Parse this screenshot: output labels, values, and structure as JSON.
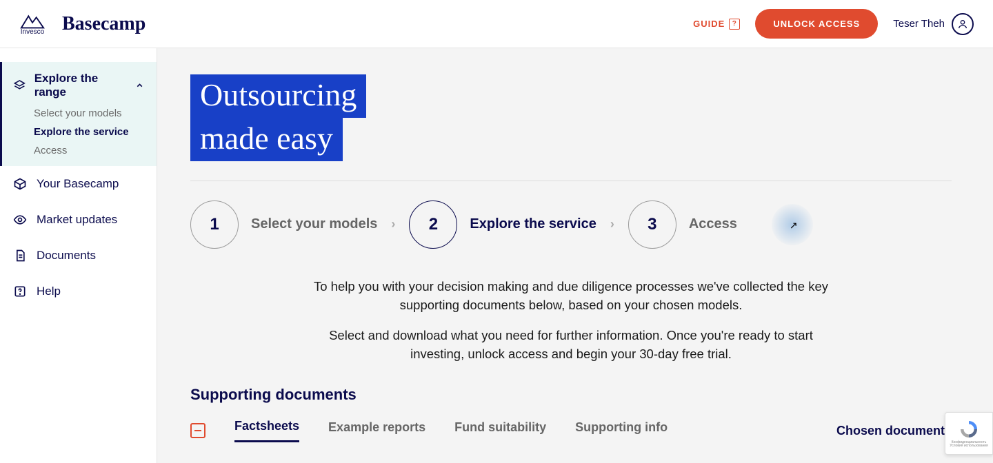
{
  "header": {
    "logo_text": "Invesco",
    "brand": "Basecamp",
    "guide_label": "GUIDE",
    "unlock_label": "UNLOCK ACCESS",
    "user_name": "Teser Theh"
  },
  "sidebar": {
    "explore_label": "Explore the range",
    "sub": {
      "select_models": "Select your models",
      "explore_service": "Explore the service",
      "access": "Access"
    },
    "items": {
      "basecamp": "Your Basecamp",
      "market": "Market updates",
      "documents": "Documents",
      "help": "Help"
    }
  },
  "hero": {
    "line1": "Outsourcing",
    "line2": "made easy"
  },
  "steps": {
    "s1": {
      "num": "1",
      "label": "Select your models"
    },
    "s2": {
      "num": "2",
      "label": "Explore the service"
    },
    "s3": {
      "num": "3",
      "label": "Access"
    }
  },
  "intro": {
    "p1": "To help you with your decision making and due diligence processes we've collected the key supporting documents below, based on your chosen models.",
    "p2": "Select and download what you need for further information. Once you're ready to start investing, unlock access and begin your 30-day free trial."
  },
  "docs": {
    "heading": "Supporting documents",
    "tabs": {
      "factsheets": "Factsheets",
      "example_reports": "Example reports",
      "fund_suitability": "Fund suitability",
      "supporting_info": "Supporting info"
    },
    "chosen_label": "Chosen documents"
  },
  "recaptcha": {
    "line1": "Конфиденциальность",
    "line2": "Условия использования"
  }
}
